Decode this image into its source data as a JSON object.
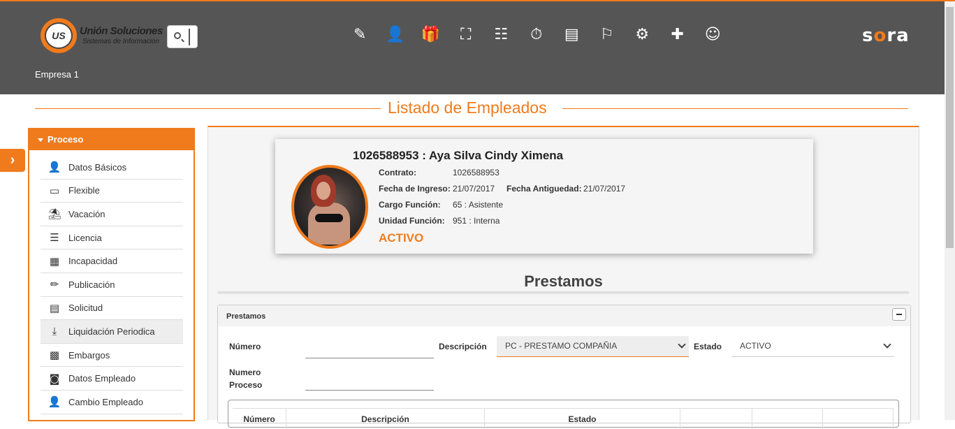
{
  "header": {
    "brand_title": "Unión Soluciones",
    "brand_subtitle": "Sistemas de Información",
    "logo_text": "US",
    "sora_prefix": "s",
    "sora_o": "o",
    "sora_suffix": "ra",
    "company": "Empresa 1",
    "icons": [
      "edit-doc-icon",
      "employee-icon",
      "gift-icon",
      "org-chart-icon",
      "id-card-icon",
      "timer-icon",
      "document-list-icon",
      "presentation-icon",
      "gears-icon",
      "medical-kit-icon",
      "support-team-icon"
    ]
  },
  "page_title": "Listado de Empleados",
  "sidebar": {
    "header": "Proceso",
    "items": [
      {
        "label": "Datos Básicos",
        "icon": "person-icon"
      },
      {
        "label": "Flexible",
        "icon": "money-icon"
      },
      {
        "label": "Vacación",
        "icon": "beach-chair-icon"
      },
      {
        "label": "Licencia",
        "icon": "list-doc-icon"
      },
      {
        "label": "Incapacidad",
        "icon": "building-icon"
      },
      {
        "label": "Publicación",
        "icon": "pencil-icon"
      },
      {
        "label": "Solicitud",
        "icon": "form-icon"
      },
      {
        "label": "Liquidación Periodica",
        "icon": "download-icon"
      },
      {
        "label": "Embargos",
        "icon": "calculator-icon"
      },
      {
        "label": "Datos Empleado",
        "icon": "contact-icon"
      },
      {
        "label": "Cambio Empleado",
        "icon": "person-swap-icon"
      }
    ]
  },
  "employee": {
    "name": "1026588953 : Aya Silva Cindy Ximena",
    "contrato_label": "Contrato:",
    "contrato": "1026588953",
    "ingreso_label": "Fecha de Ingreso:",
    "ingreso": "21/07/2017",
    "antiguedad_label": "Fecha Antiguedad:",
    "antiguedad": "21/07/2017",
    "cargo_label": "Cargo Función:",
    "cargo": "65 : Asistente",
    "unidad_label": "Unidad Función:",
    "unidad": "951 : Interna",
    "status": "ACTIVO"
  },
  "section_title": "Prestamos",
  "panel": {
    "title": "Prestamos",
    "numero_label": "Número",
    "numero_value": "",
    "descripcion_label": "Descripción",
    "descripcion_value": "PC - PRESTAMO COMPAÑIA",
    "estado_label": "Estado",
    "estado_value": "ACTIVO",
    "numero_proceso_label_1": "Numero",
    "numero_proceso_label_2": "Proceso",
    "numero_proceso_value": ""
  },
  "table": {
    "columns": [
      "Número",
      "Descripción",
      "Estado",
      "",
      "",
      ""
    ]
  },
  "colors": {
    "accent": "#f07b1d",
    "header_bg": "#555555"
  }
}
